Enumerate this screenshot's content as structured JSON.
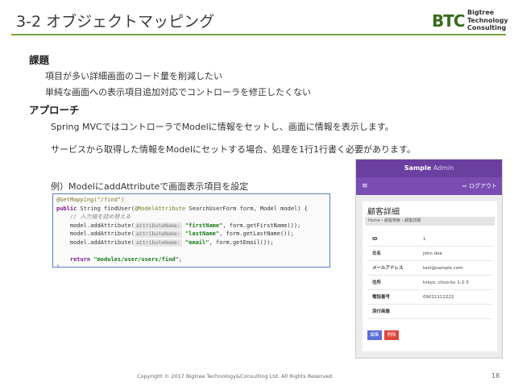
{
  "title": "3-2 オブジェクトマッピング",
  "logo": {
    "mark": "BTC",
    "lines": [
      "Bigtree",
      "Technology",
      "Consulting"
    ]
  },
  "issue": {
    "heading": "課題",
    "lines": [
      "項目が多い詳細画面のコード量を削減したい",
      "単純な画面への表示項目追加対応でコントローラを修正したくない"
    ]
  },
  "approach": {
    "heading": "アプローチ",
    "lines": [
      "Spring MVCではコントローラでModelに情報をセットし、画面に情報を表示します。",
      "サービスから取得した情報をModelにセットする場合、処理を1行1行書く必要があります。"
    ],
    "example": "例）ModelにaddAttributeで画面表示項目を設定"
  },
  "code": {
    "l1": "@GetMapping(\"/find\")",
    "l2_kw1": "public",
    "l2_mid": " String findUser(",
    "l2_ann": "@ModelAttribute",
    "l2_end": " SearchUserForm form, Model model) {",
    "comment": "    // 入力値を詰め替える",
    "call": "    model.addAttribute(",
    "hint": "attributeName:",
    "a1_str": "\"firstName\"",
    "a1_rest": ", form.getFirstName());",
    "a2_str": "\"lastName\"",
    "a2_rest": ", form.getLastName());",
    "a3_str": "\"email\"",
    "a3_rest": ", form.getEmail());",
    "ret_kw": "    return",
    "ret_str": " \"modules/user/users/find\"",
    "ret_end": ";",
    "close": "}"
  },
  "mock": {
    "brand_bold": "Sample",
    "brand_light": " Admin",
    "menu_icon": "≡",
    "logout": "⇨ ログアウト",
    "heading": "顧客詳細",
    "breadcrumb": "Home  ›  顧客検索  ›  顧客詳細",
    "rows": [
      {
        "k": "ID",
        "v": "1"
      },
      {
        "k": "氏名",
        "v": "john doe"
      },
      {
        "k": "メールアドレス",
        "v": "test@sample.com"
      },
      {
        "k": "住所",
        "v": "tokyo, chuo-ku 1-2-3"
      },
      {
        "k": "電話番号",
        "v": "09011112222"
      },
      {
        "k": "添付画像",
        "v": ""
      }
    ],
    "edit": "編集",
    "delete": "削除",
    "colors": {
      "header": "#6b3fa0",
      "edit": "#5a6fd6",
      "delete": "#e0453a"
    }
  },
  "footer": "Copyright © 2017 Bigtree Technology&Consulting Ltd. All Rights Reserved.",
  "page": "18"
}
